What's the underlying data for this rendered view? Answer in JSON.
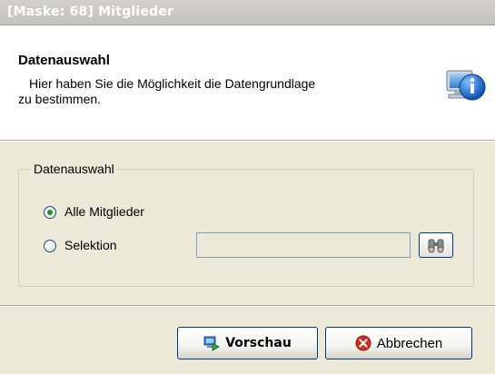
{
  "window": {
    "title": "[Maske: 68] Mitglieder"
  },
  "header": {
    "title": "Datenauswahl",
    "description_line1": "Hier haben Sie die Möglichkeit die Datengrundlage",
    "description_line2": "zu bestimmen.",
    "icon": "info-computer-icon"
  },
  "group": {
    "label": "Datenauswahl",
    "options": [
      {
        "label": "Alle Mitglieder",
        "selected": true
      },
      {
        "label": "Selektion",
        "selected": false
      }
    ],
    "selection_value": "",
    "search_icon": "binoculars-icon"
  },
  "buttons": {
    "preview_label": "Vorschau",
    "preview_icon": "preview-icon",
    "cancel_label": "Abbrechen",
    "cancel_icon": "cancel-icon"
  },
  "colors": {
    "dialog_bg": "#ece9d8",
    "header_bg": "#ffffff",
    "title_bar": "#c3c2bf",
    "radio_dot": "#2e8b2e",
    "cancel_red": "#d42a1a"
  }
}
